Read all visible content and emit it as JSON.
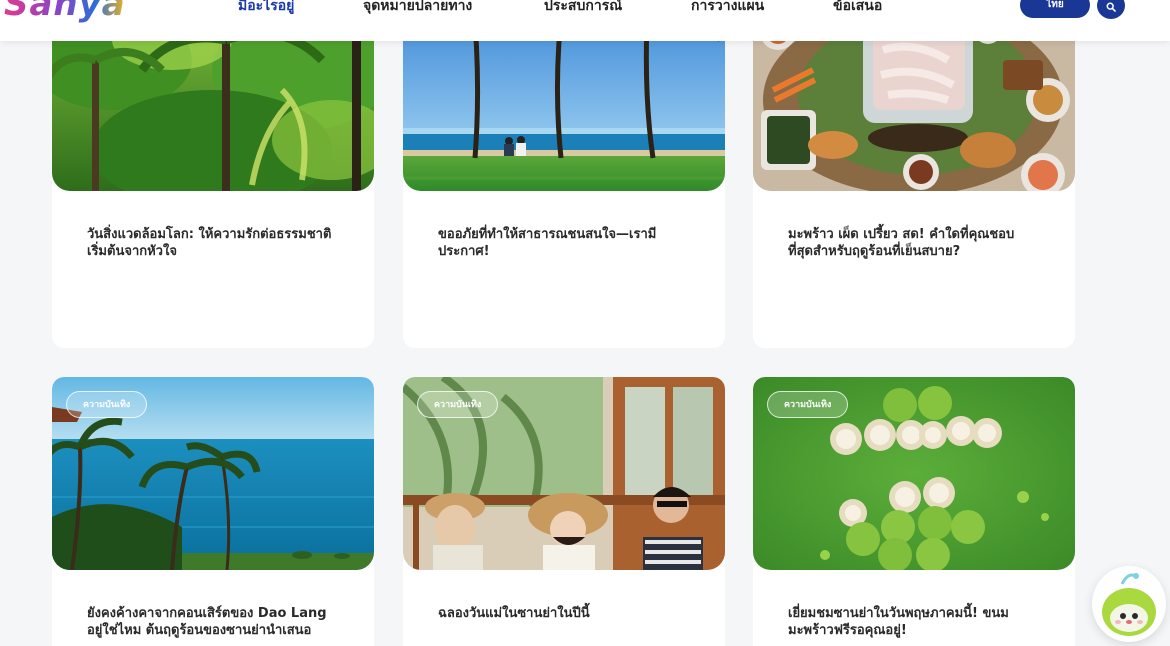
{
  "header": {
    "logo_text": "Sanya",
    "nav": [
      {
        "label": "มีอะไรอยู่",
        "active": true
      },
      {
        "label": "จุดหมายปลายทาง",
        "active": false
      },
      {
        "label": "ประสบการณ์",
        "active": false
      },
      {
        "label": "การวางแผน",
        "active": false
      },
      {
        "label": "ข้อเสนอ",
        "active": false
      }
    ],
    "language_button": "ไทย",
    "search_icon": "search-icon"
  },
  "cards": [
    {
      "title": "วันสิ่งแวดล้อมโลก: ให้ความรักต่อธรรมชาติ เริ่มต้นจากหัวใจ",
      "image": "tropical palm trees"
    },
    {
      "title": "ขออภัยที่ทำให้สาธารณชนสนใจ—เรามีประกาศ!",
      "image": "couple sitting on lawn by the sea"
    },
    {
      "title": "มะพร้าว เผ็ด เปรี้ยว สด! คำใดที่คุณชอบที่สุดสำหรับฤดูร้อนที่เย็นสบาย?",
      "image": "hotpot feast"
    },
    {
      "title": "ยังคงค้างคาจากคอนเสิร์ตของ Dao Lang อยู่ใช่ไหม ต้นฤดูร้อนของซานย่านำเสนอ",
      "badge": "ความบันเทิง",
      "image": "palm trees and blue sea"
    },
    {
      "title": "ฉลองวันแม่ในซานย่าในปีนี้",
      "badge": "ความบันเทิง",
      "image": "family with sun hats"
    },
    {
      "title": "เยี่ยมชมซานย่าในวันพฤษภาคมนี้! ขนมมะพร้าวฟรีรอคุณอยู่!",
      "badge": "ความบันเทิง",
      "image": "coconuts on grass"
    }
  ],
  "colors": {
    "brand_blue": "#1a3796",
    "active_nav": "#1b38a8",
    "page_bg": "#f5f6f8"
  },
  "mascot": {
    "icon": "coconut-mascot-icon"
  }
}
